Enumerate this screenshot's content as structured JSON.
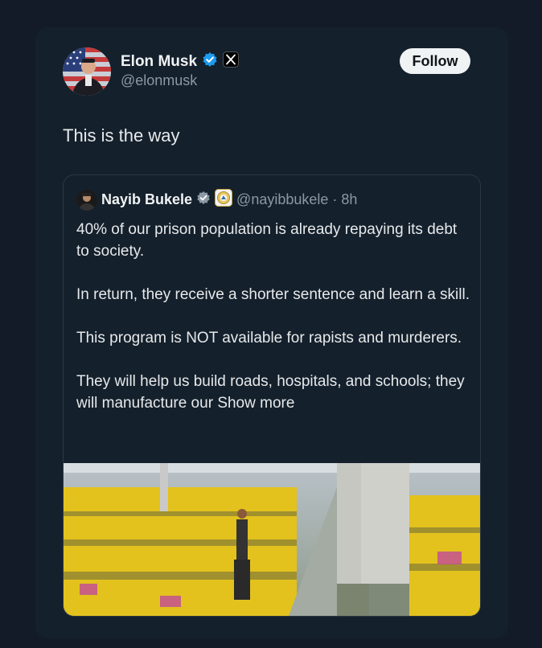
{
  "tweet": {
    "author_name": "Elon Musk",
    "author_handle": "@elonmusk",
    "follow_label": "Follow",
    "text": "This is the way",
    "verified_icon": "verified-badge-icon",
    "affiliate_icon": "x-logo-icon"
  },
  "quote": {
    "author_name": "Nayib Bukele",
    "author_handle": "@nayibbukele",
    "separator": "·",
    "time": "8h",
    "paragraphs": [
      "40% of our prison population is already repaying its debt to society.",
      "In return, they receive a shorter sentence and learn a skill.",
      "This program is NOT available for rapists and murderers.",
      "They will help us build roads, hospitals, and schools; they will manufacture our"
    ],
    "show_more": "Show more",
    "verified_icon": "verified-badge-icon",
    "affiliate_icon": "government-seal-icon"
  },
  "colors": {
    "background": "#121b27",
    "card": "#14202c",
    "text": "#e7e9ea",
    "secondary_text": "#8b98a5",
    "verified_blue": "#1d9bf0",
    "uniform_yellow": "#e3c21d"
  }
}
